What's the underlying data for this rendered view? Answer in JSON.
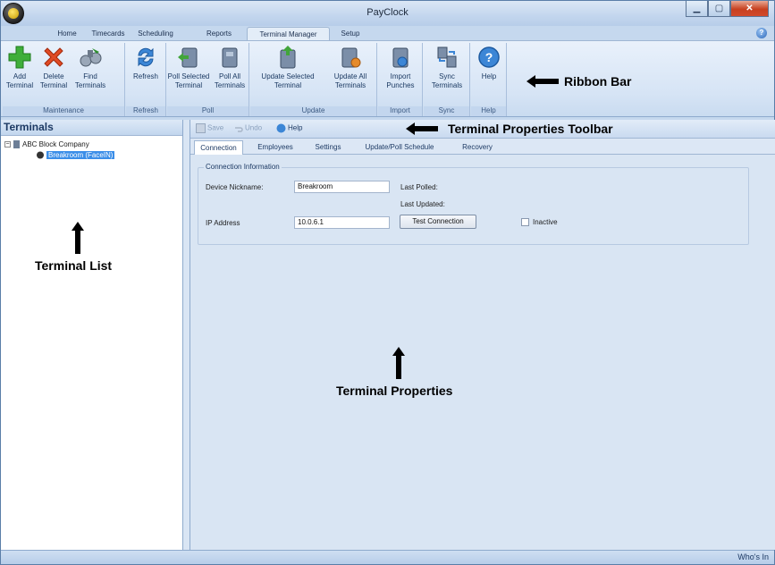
{
  "window": {
    "title": "PayClock"
  },
  "tabs": [
    "Home",
    "Timecards",
    "Scheduling",
    "Reports",
    "Terminal Manager",
    "Setup"
  ],
  "active_tab": "Terminal Manager",
  "ribbon": {
    "groups": [
      {
        "label": "Maintenance",
        "buttons": [
          "Add\nTerminal",
          "Delete\nTerminal",
          "Find\nTerminals"
        ]
      },
      {
        "label": "Refresh",
        "buttons": [
          "Refresh"
        ]
      },
      {
        "label": "Poll",
        "buttons": [
          "Poll Selected\nTerminal",
          "Poll All\nTerminals"
        ]
      },
      {
        "label": "Update",
        "buttons": [
          "Update Selected\nTerminal",
          "Update All\nTerminals"
        ]
      },
      {
        "label": "Import",
        "buttons": [
          "Import\nPunches"
        ]
      },
      {
        "label": "Sync",
        "buttons": [
          "Sync\nTerminals"
        ]
      },
      {
        "label": "Help",
        "buttons": [
          "Help"
        ]
      }
    ]
  },
  "annotations": {
    "ribbon_bar": "Ribbon Bar",
    "toolbar": "Terminal Properties Toolbar",
    "terminal_list": "Terminal List",
    "terminal_properties": "Terminal Properties"
  },
  "left_pane": {
    "title": "Terminals",
    "tree": {
      "company": "ABC Block Company",
      "terminal": "Breakroom (FaceIN)"
    }
  },
  "props_toolbar": {
    "save": "Save",
    "undo": "Undo",
    "help": "Help"
  },
  "props_tabs": [
    "Connection",
    "Employees",
    "Settings",
    "Update/Poll Schedule",
    "Recovery"
  ],
  "props_active_tab": "Connection",
  "connection": {
    "legend": "Connection Information",
    "nickname_label": "Device Nickname:",
    "nickname_value": "Breakroom",
    "last_polled_label": "Last Polled:",
    "last_updated_label": "Last Updated:",
    "ip_label": "IP Address",
    "ip_value": "10.0.6.1",
    "test_button": "Test Connection",
    "inactive_label": "Inactive",
    "inactive_checked": false
  },
  "status": {
    "whos_in": "Who's In"
  },
  "colors": {
    "accent": "#3b8ee8",
    "frame": "#c5d8ee"
  }
}
